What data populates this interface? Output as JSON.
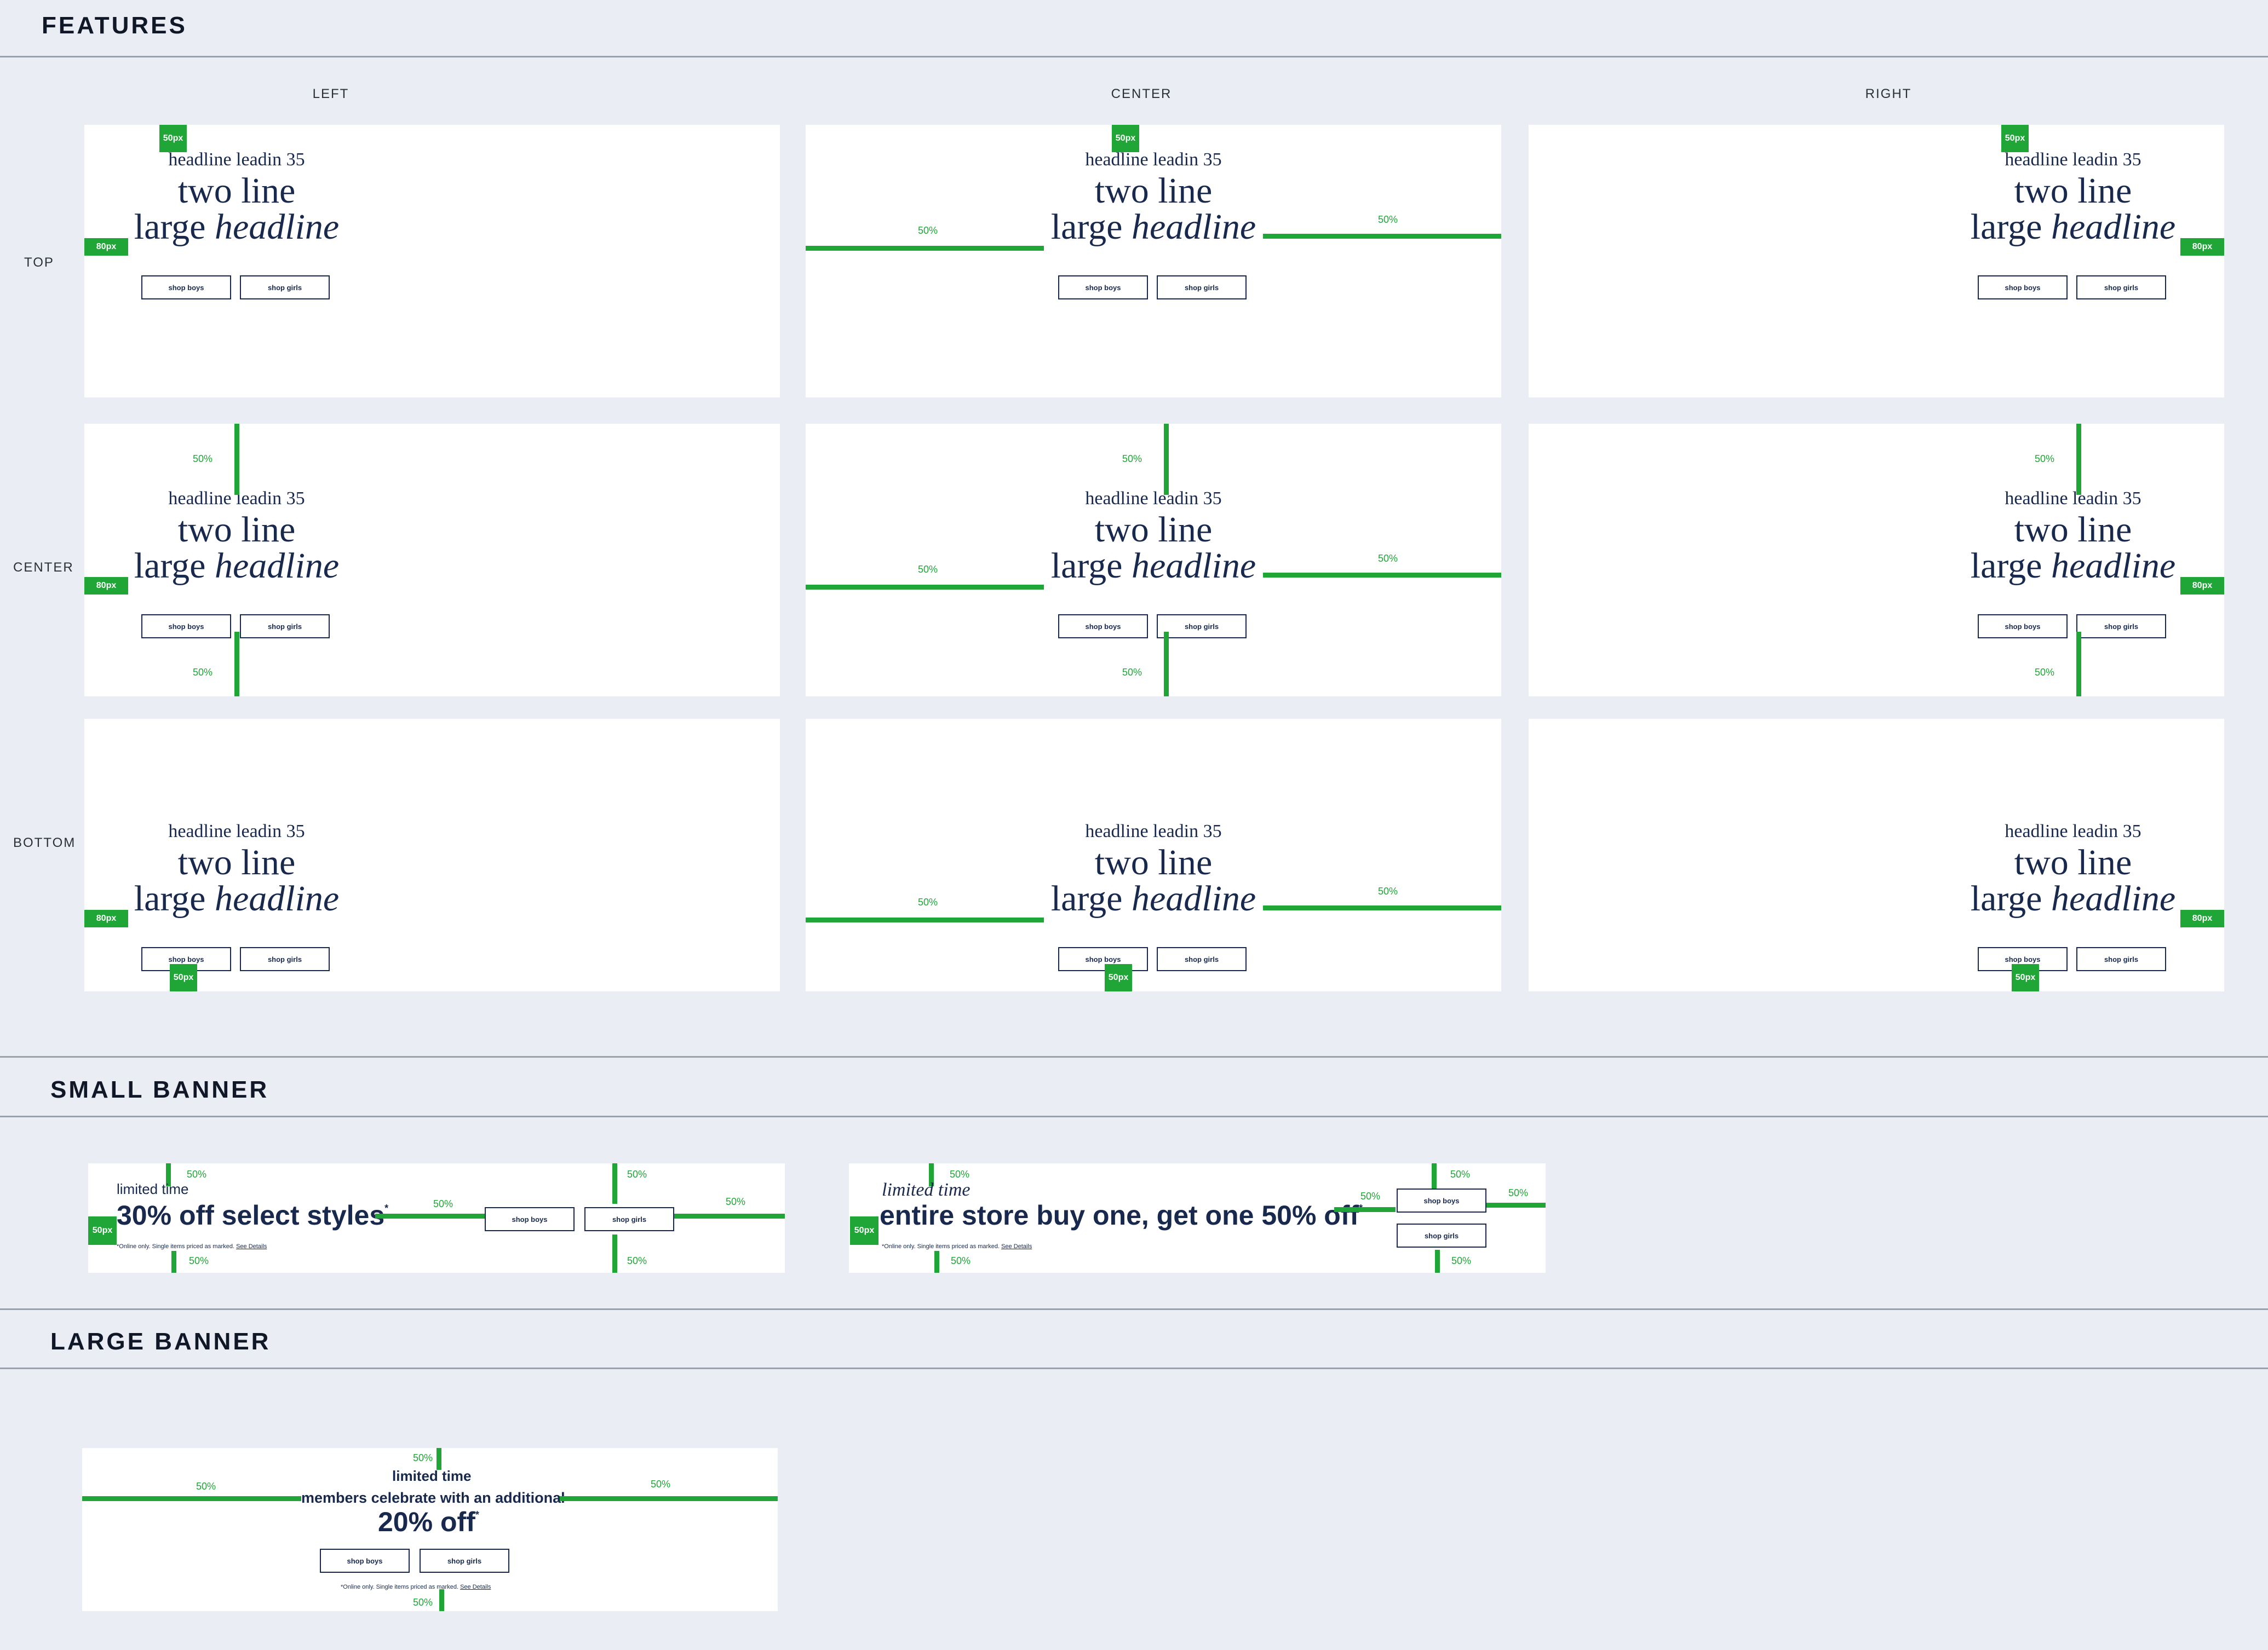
{
  "sections": {
    "features": "FEATURES",
    "small_banner": "SMALL BANNER",
    "large_banner": "LARGE BANNER"
  },
  "columns": [
    "LEFT",
    "CENTER",
    "RIGHT"
  ],
  "rows": [
    "TOP",
    "CENTER",
    "BOTTOM"
  ],
  "feature": {
    "leadin": "headline leadin 35",
    "line1": "two line",
    "line2_plain": "large ",
    "line2_italic": "headline",
    "shop_boys": "shop boys",
    "shop_girls": "shop girls"
  },
  "guides": {
    "p50": "50%",
    "px50": "50px",
    "px80": "80px"
  },
  "small_banner": {
    "a": {
      "limited": "limited time",
      "headline": "30% off select styles",
      "mark": "*",
      "fine": "*Online only. Single items priced as marked. ",
      "details": "See Details"
    },
    "b": {
      "limited": "limited time",
      "headline": "entire store buy one, get one 50% off",
      "mark": "*",
      "fine": "*Online only. Single items priced as marked. ",
      "details": "See Details"
    }
  },
  "large_banner": {
    "limited": "limited time",
    "line1": "members celebrate with an additional",
    "line2": "20% off",
    "mark": "*",
    "fine": "*Online only. Single items priced as marked. ",
    "details": "See Details"
  },
  "colors": {
    "guide_green": "#1fa637",
    "navy": "#18294d",
    "page_bg": "#eaedf4"
  }
}
